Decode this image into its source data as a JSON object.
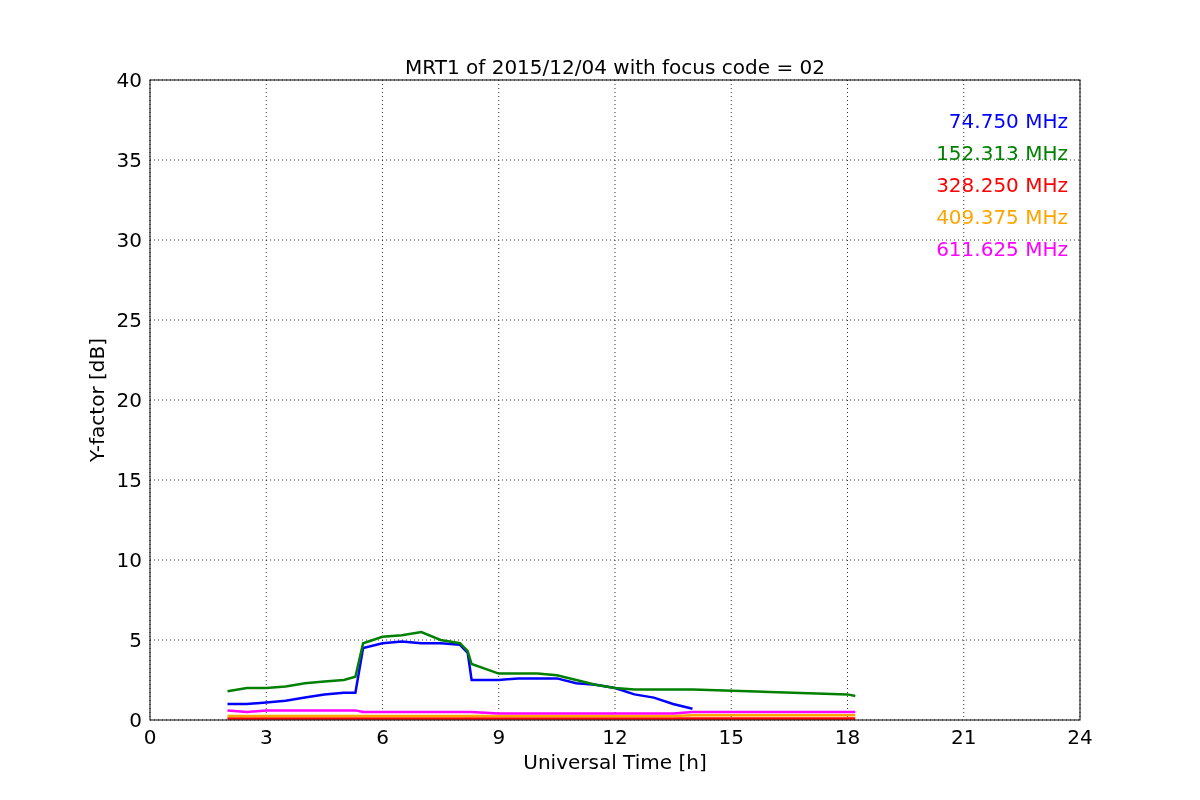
{
  "figure": {
    "chart_data": {
      "type": "line",
      "title": "MRT1 of 2015/12/04 with focus code = 02",
      "xlabel": "Universal Time [h]",
      "ylabel": "Y-factor [dB]",
      "x": [
        2,
        2.5,
        3,
        3.5,
        4,
        4.5,
        5,
        5.3,
        5.5,
        6,
        6.5,
        7,
        7.5,
        8,
        8.2,
        8.3,
        9,
        9.5,
        10,
        10.5,
        11,
        11.5,
        12,
        12.5,
        13,
        13.5,
        14,
        18,
        18.2
      ],
      "series": [
        {
          "name": "74.750 MHz",
          "color": "#0000ff",
          "values": [
            1.0,
            1.0,
            1.1,
            1.2,
            1.4,
            1.6,
            1.7,
            1.7,
            4.5,
            4.8,
            4.9,
            4.8,
            4.8,
            4.7,
            4.2,
            2.5,
            2.5,
            2.6,
            2.6,
            2.6,
            2.3,
            2.2,
            2.0,
            1.6,
            1.4,
            1.0,
            0.7,
            null,
            null
          ]
        },
        {
          "name": "152.313 MHz",
          "color": "#008000",
          "values": [
            1.8,
            2.0,
            2.0,
            2.1,
            2.3,
            2.4,
            2.5,
            2.7,
            4.8,
            5.2,
            5.3,
            5.5,
            5.0,
            4.8,
            4.3,
            3.5,
            2.9,
            2.9,
            2.9,
            2.8,
            2.5,
            2.2,
            2.0,
            1.9,
            1.9,
            1.9,
            1.9,
            1.6,
            1.5
          ]
        },
        {
          "name": "328.250 MHz",
          "color": "#ff0000",
          "values": [
            0.1,
            0.1,
            0.1,
            0.1,
            0.1,
            0.1,
            0.1,
            0.1,
            0.1,
            0.1,
            0.1,
            0.1,
            0.1,
            0.1,
            0.1,
            0.1,
            0.1,
            0.1,
            0.1,
            0.1,
            0.1,
            0.1,
            0.1,
            0.1,
            0.1,
            0.1,
            0.1,
            0.1,
            0.1
          ]
        },
        {
          "name": "409.375 MHz",
          "color": "#ffa500",
          "values": [
            0.25,
            0.25,
            0.25,
            0.25,
            0.25,
            0.25,
            0.25,
            0.25,
            0.25,
            0.25,
            0.25,
            0.25,
            0.25,
            0.25,
            0.25,
            0.25,
            0.25,
            0.25,
            0.25,
            0.25,
            0.25,
            0.25,
            0.25,
            0.25,
            0.25,
            0.25,
            0.3,
            0.3,
            0.3
          ]
        },
        {
          "name": "611.625 MHz",
          "color": "#ff00ff",
          "values": [
            0.6,
            0.5,
            0.6,
            0.6,
            0.6,
            0.6,
            0.6,
            0.6,
            0.5,
            0.5,
            0.5,
            0.5,
            0.5,
            0.5,
            0.5,
            0.5,
            0.4,
            0.4,
            0.4,
            0.4,
            0.4,
            0.4,
            0.4,
            0.4,
            0.4,
            0.4,
            0.5,
            0.5,
            0.5
          ]
        }
      ],
      "grid": true,
      "xlim": [
        0,
        24
      ],
      "ylim": [
        0,
        40
      ],
      "xticks": [
        0,
        3,
        6,
        9,
        12,
        15,
        18,
        21,
        24
      ],
      "yticks": [
        0,
        5,
        10,
        15,
        20,
        25,
        30,
        35,
        40
      ]
    }
  }
}
